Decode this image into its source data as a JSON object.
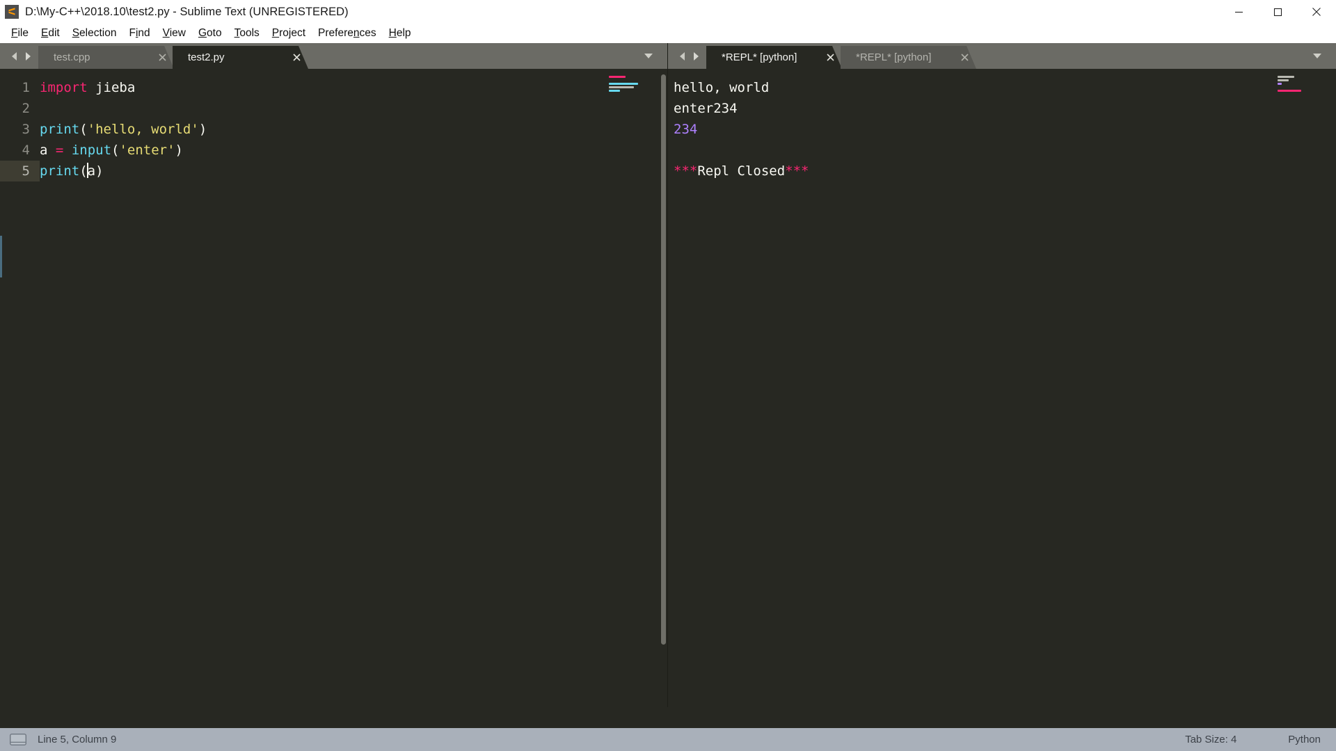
{
  "window": {
    "title": "D:\\My-C++\\2018.10\\test2.py - Sublime Text (UNREGISTERED)",
    "icon": "sublime-logo-icon",
    "controls": {
      "minimize": "minimize-icon",
      "maximize": "maximize-icon",
      "close": "close-icon"
    }
  },
  "menubar": {
    "items": [
      {
        "label": "File",
        "accel": "F"
      },
      {
        "label": "Edit",
        "accel": "E"
      },
      {
        "label": "Selection",
        "accel": "S"
      },
      {
        "label": "Find",
        "accel": "i"
      },
      {
        "label": "View",
        "accel": "V"
      },
      {
        "label": "Goto",
        "accel": "G"
      },
      {
        "label": "Tools",
        "accel": "T"
      },
      {
        "label": "Project",
        "accel": "P"
      },
      {
        "label": "Preferences",
        "accel": "n"
      },
      {
        "label": "Help",
        "accel": "H"
      }
    ]
  },
  "left_pane": {
    "tabs": [
      {
        "label": "test.cpp",
        "active": false,
        "close": "close-icon"
      },
      {
        "label": "test2.py",
        "active": true,
        "close": "close-icon"
      }
    ],
    "nav_prev": "arrow-left-icon",
    "nav_next": "arrow-right-icon",
    "tab_menu": "chevron-down-icon",
    "code": {
      "line_numbers": [
        "1",
        "2",
        "3",
        "4",
        "5"
      ],
      "current_line": 5,
      "lines": [
        {
          "n": "1",
          "tokens": [
            {
              "t": "import",
              "c": "kw"
            },
            {
              "t": " ",
              "c": "plain"
            },
            {
              "t": "jieba",
              "c": "plain"
            }
          ]
        },
        {
          "n": "2",
          "tokens": []
        },
        {
          "n": "3",
          "tokens": [
            {
              "t": "print",
              "c": "fn"
            },
            {
              "t": "(",
              "c": "punct"
            },
            {
              "t": "'hello, world'",
              "c": "str"
            },
            {
              "t": ")",
              "c": "punct"
            }
          ]
        },
        {
          "n": "4",
          "tokens": [
            {
              "t": "a",
              "c": "plain"
            },
            {
              "t": " ",
              "c": "plain"
            },
            {
              "t": "=",
              "c": "kw"
            },
            {
              "t": " ",
              "c": "plain"
            },
            {
              "t": "input",
              "c": "fn"
            },
            {
              "t": "(",
              "c": "punct"
            },
            {
              "t": "'enter'",
              "c": "str"
            },
            {
              "t": ")",
              "c": "punct"
            }
          ]
        },
        {
          "n": "5",
          "tokens": [
            {
              "t": "print",
              "c": "fn"
            },
            {
              "t": "(",
              "c": "punct"
            },
            {
              "t": "a",
              "c": "plain"
            },
            {
              "t": ")",
              "c": "punct"
            }
          ]
        }
      ],
      "plain_text": "import jieba\n\nprint('hello, world')\na = input('enter')\nprint(a)"
    }
  },
  "right_pane": {
    "tabs": [
      {
        "label": "*REPL* [python]",
        "active": true,
        "close": "close-icon"
      },
      {
        "label": "*REPL* [python]",
        "active": false,
        "close": "close-icon"
      }
    ],
    "nav_prev": "arrow-left-icon",
    "nav_next": "arrow-right-icon",
    "tab_menu": "chevron-down-icon",
    "output": {
      "lines": [
        {
          "tokens": [
            {
              "t": "hello, world",
              "c": "plain"
            }
          ]
        },
        {
          "tokens": [
            {
              "t": "enter234",
              "c": "plain"
            }
          ]
        },
        {
          "tokens": [
            {
              "t": "234",
              "c": "num"
            }
          ]
        },
        {
          "tokens": []
        },
        {
          "tokens": [
            {
              "t": "***",
              "c": "kw"
            },
            {
              "t": "Repl Closed",
              "c": "plain"
            },
            {
              "t": "***",
              "c": "kw"
            }
          ]
        }
      ],
      "plain_text": "hello, world\nenter234\n234\n\n***Repl Closed***"
    }
  },
  "statusbar": {
    "console_icon": "console-icon",
    "cursor_position": "Line 5, Column 9",
    "tab_size": "Tab Size: 4",
    "syntax": "Python"
  },
  "colors": {
    "background": "#272822",
    "tabbar": "#6b6b65",
    "tab_inactive": "#585853",
    "statusbar": "#a9b0ba",
    "keyword": "#f92672",
    "function": "#66d9ef",
    "string": "#e6db74",
    "number": "#ae81ff",
    "foreground": "#f8f8f2",
    "gutter_text": "#8d8d86",
    "current_line": "#3e3d32"
  }
}
